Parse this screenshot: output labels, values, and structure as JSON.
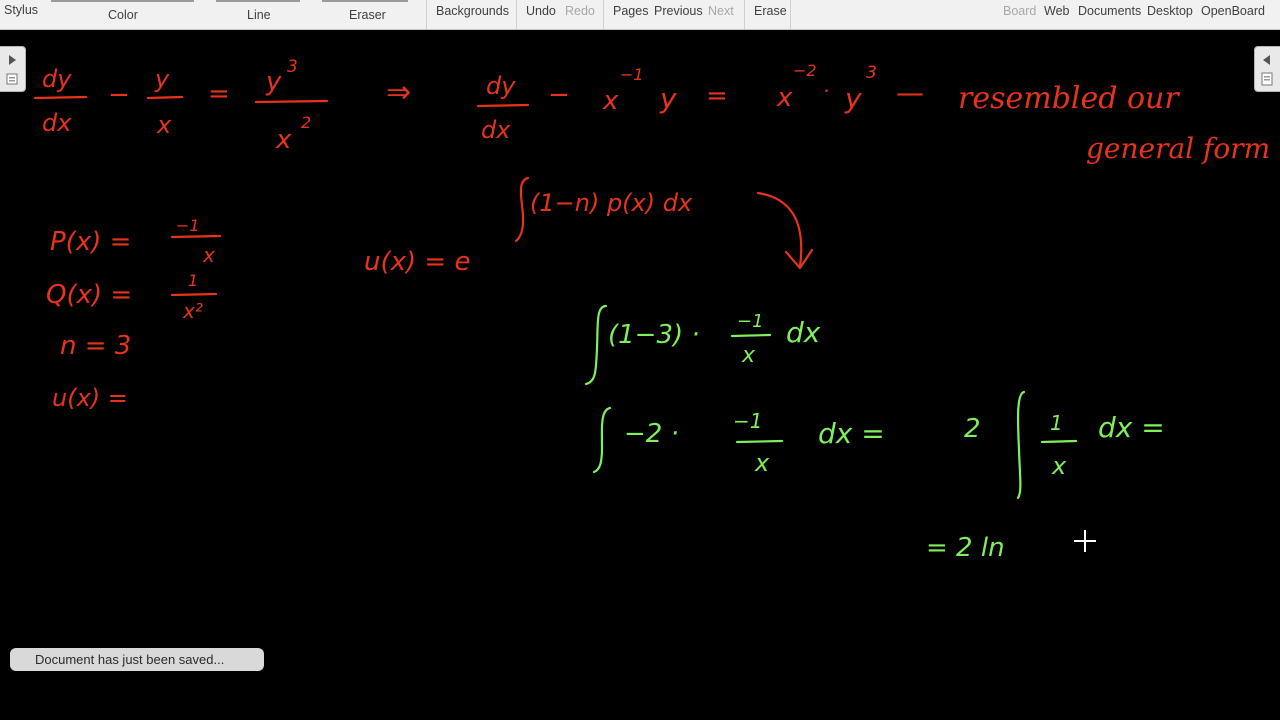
{
  "toolbar": {
    "stylus": "Stylus",
    "color": "Color",
    "line": "Line",
    "eraser": "Eraser",
    "backgrounds": "Backgrounds",
    "undo": "Undo",
    "redo": "Redo",
    "pages": "Pages",
    "previous": "Previous",
    "next": "Next",
    "erase": "Erase",
    "board": "Board",
    "web": "Web",
    "documents": "Documents",
    "desktop": "Desktop",
    "openboard": "OpenBoard"
  },
  "board": {
    "ink_colors": {
      "red": "#e8331c",
      "green": "#7ff05a"
    },
    "handwriting": {
      "eq1_dy": "dy",
      "eq1_dx": "dx",
      "eq1_minus": "−",
      "eq1_y": "y",
      "eq1_x": "x",
      "eq1_equals": "=",
      "eq1_y_power": "y",
      "eq1_exp3": "3",
      "eq1_x2": "x",
      "eq1_exp2": "2",
      "implies": "⇒",
      "eq2_dy": "dy",
      "eq2_dx": "dx",
      "eq2_minus": "−",
      "eq2_x": "x",
      "eq2_exp_neg1": "−1",
      "eq2_y": "y",
      "eq2_equals": "=",
      "eq2_x2": "x",
      "eq2_exp_neg2": "−2",
      "eq2_dot": "·",
      "eq2_y3": "y",
      "eq2_exp3": "3",
      "dash": "—",
      "note_line1": "resembled our",
      "note_line2": "general form",
      "p_label": "P(x) =",
      "p_num": "−1",
      "p_den": "x",
      "q_label": "Q(x) =",
      "q_num": "1",
      "q_den": "x²",
      "n_label": "n  =  3",
      "u_left_label": "u(x) =",
      "u_main": "u(x)  =  e",
      "u_exponent": "(1−n) p(x) dx",
      "g1_body": "(1−3) ·",
      "g1_num": "−1",
      "g1_den": "x",
      "g1_dx": "dx",
      "g2_part1": "−2 ·",
      "g2_num": "−1",
      "g2_den": "x",
      "g2_dx": "dx  =",
      "g2_coef": "2",
      "g2_num2": "1",
      "g2_den2": "x",
      "g2_dx2": "dx  =",
      "g3": "= 2 ln"
    }
  },
  "status": {
    "toast": "Document has just been saved..."
  }
}
